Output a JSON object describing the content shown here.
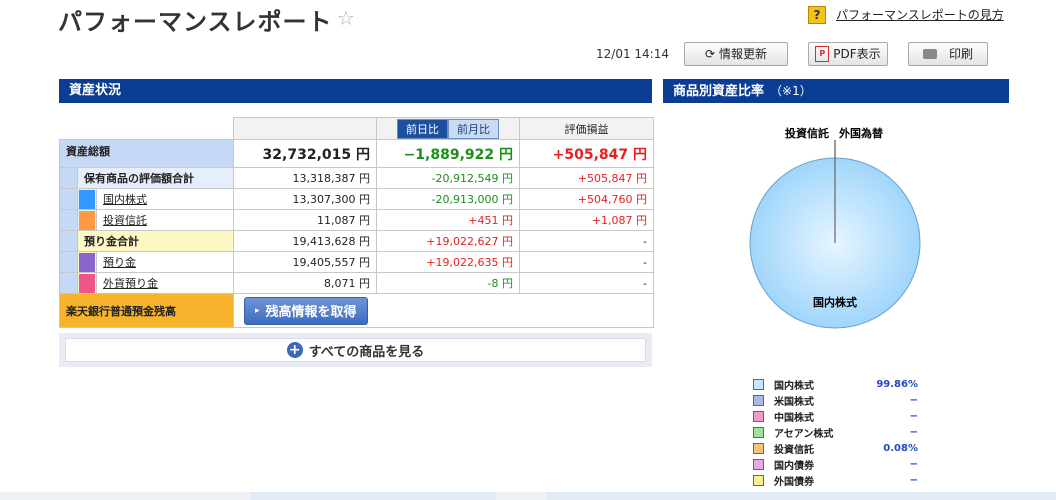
{
  "header": {
    "title": "パフォーマンスレポート",
    "help_icon": "?",
    "help_link": "パフォーマンスレポートの見方",
    "timestamp": "12/01 14:14",
    "refresh_label": "情報更新",
    "pdf_label": "PDF表示",
    "print_label": "印刷"
  },
  "section_assets": {
    "title": "資産状況"
  },
  "section_ratio": {
    "title": "商品別資産比率",
    "note": "（※1）"
  },
  "table": {
    "tabs": [
      "前日比",
      "前月比"
    ],
    "col_pl": "評価損益",
    "total": {
      "label": "資産総額",
      "value": "32,732,015 円",
      "change": "−1,889,922 円",
      "pl": "+505,847 円"
    },
    "holdings": {
      "label": "保有商品の評価額合計",
      "value": "13,318,387 円",
      "change": "-20,912,549 円",
      "pl": "+505,847 円"
    },
    "domestic": {
      "label": "国内株式",
      "value": "13,307,300 円",
      "change": "-20,913,000 円",
      "pl": "+504,760 円",
      "color": "#3399ff"
    },
    "trust": {
      "label": "投資信託",
      "value": "11,087 円",
      "change": "+451 円",
      "pl": "+1,087 円",
      "color": "#ff9944"
    },
    "deposit_total": {
      "label": "預り金合計",
      "value": "19,413,628 円",
      "change": "+19,022,627 円",
      "pl": "-"
    },
    "deposit": {
      "label": "預り金",
      "value": "19,405,557 円",
      "change": "+19,022,635 円",
      "pl": "-",
      "color": "#8866cc"
    },
    "fx_deposit": {
      "label": "外貨預り金",
      "value": "8,071 円",
      "change": "-8 円",
      "pl": "-",
      "color": "#ee5588"
    },
    "bank": {
      "label": "楽天銀行普通預金残高",
      "button": "残高情報を取得"
    }
  },
  "see_all": {
    "label": "すべての商品を見る"
  },
  "pie": {
    "labels": [
      "投資信託",
      "外国為替",
      "国内株式"
    ]
  },
  "chart_data": {
    "type": "pie",
    "title": "",
    "categories": [
      "国内株式",
      "米国株式",
      "中国株式",
      "アセアン株式",
      "投資信託",
      "国内債券",
      "外国債券"
    ],
    "values": [
      99.86,
      null,
      null,
      null,
      0.08,
      null,
      null
    ],
    "colors": [
      "#c6e6ff",
      "#aab9ea",
      "#f49ac8",
      "#9fe29f",
      "#f7c27a",
      "#e9a8e6",
      "#f5f08c"
    ]
  },
  "legend": [
    {
      "name": "国内株式",
      "pct": "99.86%",
      "color": "#c6e6ff"
    },
    {
      "name": "米国株式",
      "pct": "−",
      "color": "#aab9ea"
    },
    {
      "name": "中国株式",
      "pct": "−",
      "color": "#f49ac8"
    },
    {
      "name": "アセアン株式",
      "pct": "−",
      "color": "#9fe29f"
    },
    {
      "name": "投資信託",
      "pct": "0.08%",
      "color": "#f7c27a"
    },
    {
      "name": "国内債券",
      "pct": "−",
      "color": "#e9a8e6"
    },
    {
      "name": "外国債券",
      "pct": "−",
      "color": "#f5f08c"
    }
  ]
}
